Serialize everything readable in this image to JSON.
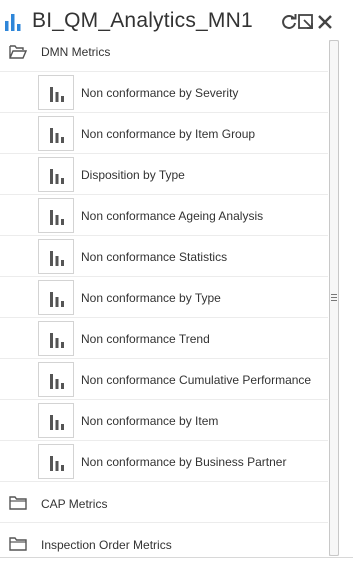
{
  "header": {
    "title": "BI_QM_Analytics_MN1",
    "app_icon": "bar-chart-icon",
    "actions": [
      {
        "name": "refresh-icon"
      },
      {
        "name": "popout-icon"
      },
      {
        "name": "close-icon"
      }
    ]
  },
  "colors": {
    "accent": "#2e86d9",
    "text": "#333333",
    "icon": "#555555",
    "divider": "#ececec"
  },
  "tree": {
    "dmn": {
      "label": "DMN Metrics",
      "icon": "folder-open-icon",
      "reports": [
        {
          "label": "Non conformance by Severity",
          "icon": "bar-chart-icon"
        },
        {
          "label": "Non conformance by Item Group",
          "icon": "bar-chart-icon"
        },
        {
          "label": "Disposition by Type",
          "icon": "bar-chart-icon"
        },
        {
          "label": "Non conformance Ageing Analysis",
          "icon": "bar-chart-icon"
        },
        {
          "label": "Non conformance Statistics",
          "icon": "bar-chart-icon"
        },
        {
          "label": "Non conformance by Type",
          "icon": "bar-chart-icon"
        },
        {
          "label": "Non conformance Trend",
          "icon": "bar-chart-icon"
        },
        {
          "label": "Non conformance Cumulative Performance",
          "icon": "bar-chart-icon"
        },
        {
          "label": "Non conformance by Item",
          "icon": "bar-chart-icon"
        },
        {
          "label": "Non conformance by Business Partner",
          "icon": "bar-chart-icon"
        }
      ]
    },
    "cap": {
      "label": "CAP Metrics",
      "icon": "folder-icon"
    },
    "inspection": {
      "label": "Inspection Order Metrics",
      "icon": "folder-icon"
    }
  }
}
